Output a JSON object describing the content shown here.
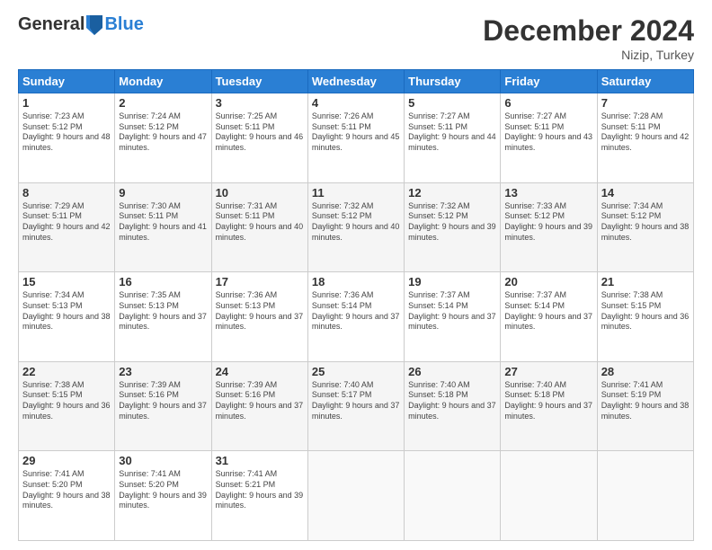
{
  "logo": {
    "general": "General",
    "blue": "Blue"
  },
  "header": {
    "month": "December 2024",
    "location": "Nizip, Turkey"
  },
  "weekdays": [
    "Sunday",
    "Monday",
    "Tuesday",
    "Wednesday",
    "Thursday",
    "Friday",
    "Saturday"
  ],
  "weeks": [
    [
      {
        "day": "1",
        "sunrise": "7:23 AM",
        "sunset": "5:12 PM",
        "daylight": "9 hours and 48 minutes."
      },
      {
        "day": "2",
        "sunrise": "7:24 AM",
        "sunset": "5:12 PM",
        "daylight": "9 hours and 47 minutes."
      },
      {
        "day": "3",
        "sunrise": "7:25 AM",
        "sunset": "5:11 PM",
        "daylight": "9 hours and 46 minutes."
      },
      {
        "day": "4",
        "sunrise": "7:26 AM",
        "sunset": "5:11 PM",
        "daylight": "9 hours and 45 minutes."
      },
      {
        "day": "5",
        "sunrise": "7:27 AM",
        "sunset": "5:11 PM",
        "daylight": "9 hours and 44 minutes."
      },
      {
        "day": "6",
        "sunrise": "7:27 AM",
        "sunset": "5:11 PM",
        "daylight": "9 hours and 43 minutes."
      },
      {
        "day": "7",
        "sunrise": "7:28 AM",
        "sunset": "5:11 PM",
        "daylight": "9 hours and 42 minutes."
      }
    ],
    [
      {
        "day": "8",
        "sunrise": "7:29 AM",
        "sunset": "5:11 PM",
        "daylight": "9 hours and 42 minutes."
      },
      {
        "day": "9",
        "sunrise": "7:30 AM",
        "sunset": "5:11 PM",
        "daylight": "9 hours and 41 minutes."
      },
      {
        "day": "10",
        "sunrise": "7:31 AM",
        "sunset": "5:11 PM",
        "daylight": "9 hours and 40 minutes."
      },
      {
        "day": "11",
        "sunrise": "7:32 AM",
        "sunset": "5:12 PM",
        "daylight": "9 hours and 40 minutes."
      },
      {
        "day": "12",
        "sunrise": "7:32 AM",
        "sunset": "5:12 PM",
        "daylight": "9 hours and 39 minutes."
      },
      {
        "day": "13",
        "sunrise": "7:33 AM",
        "sunset": "5:12 PM",
        "daylight": "9 hours and 39 minutes."
      },
      {
        "day": "14",
        "sunrise": "7:34 AM",
        "sunset": "5:12 PM",
        "daylight": "9 hours and 38 minutes."
      }
    ],
    [
      {
        "day": "15",
        "sunrise": "7:34 AM",
        "sunset": "5:13 PM",
        "daylight": "9 hours and 38 minutes."
      },
      {
        "day": "16",
        "sunrise": "7:35 AM",
        "sunset": "5:13 PM",
        "daylight": "9 hours and 37 minutes."
      },
      {
        "day": "17",
        "sunrise": "7:36 AM",
        "sunset": "5:13 PM",
        "daylight": "9 hours and 37 minutes."
      },
      {
        "day": "18",
        "sunrise": "7:36 AM",
        "sunset": "5:14 PM",
        "daylight": "9 hours and 37 minutes."
      },
      {
        "day": "19",
        "sunrise": "7:37 AM",
        "sunset": "5:14 PM",
        "daylight": "9 hours and 37 minutes."
      },
      {
        "day": "20",
        "sunrise": "7:37 AM",
        "sunset": "5:14 PM",
        "daylight": "9 hours and 37 minutes."
      },
      {
        "day": "21",
        "sunrise": "7:38 AM",
        "sunset": "5:15 PM",
        "daylight": "9 hours and 36 minutes."
      }
    ],
    [
      {
        "day": "22",
        "sunrise": "7:38 AM",
        "sunset": "5:15 PM",
        "daylight": "9 hours and 36 minutes."
      },
      {
        "day": "23",
        "sunrise": "7:39 AM",
        "sunset": "5:16 PM",
        "daylight": "9 hours and 37 minutes."
      },
      {
        "day": "24",
        "sunrise": "7:39 AM",
        "sunset": "5:16 PM",
        "daylight": "9 hours and 37 minutes."
      },
      {
        "day": "25",
        "sunrise": "7:40 AM",
        "sunset": "5:17 PM",
        "daylight": "9 hours and 37 minutes."
      },
      {
        "day": "26",
        "sunrise": "7:40 AM",
        "sunset": "5:18 PM",
        "daylight": "9 hours and 37 minutes."
      },
      {
        "day": "27",
        "sunrise": "7:40 AM",
        "sunset": "5:18 PM",
        "daylight": "9 hours and 37 minutes."
      },
      {
        "day": "28",
        "sunrise": "7:41 AM",
        "sunset": "5:19 PM",
        "daylight": "9 hours and 38 minutes."
      }
    ],
    [
      {
        "day": "29",
        "sunrise": "7:41 AM",
        "sunset": "5:20 PM",
        "daylight": "9 hours and 38 minutes."
      },
      {
        "day": "30",
        "sunrise": "7:41 AM",
        "sunset": "5:20 PM",
        "daylight": "9 hours and 39 minutes."
      },
      {
        "day": "31",
        "sunrise": "7:41 AM",
        "sunset": "5:21 PM",
        "daylight": "9 hours and 39 minutes."
      },
      null,
      null,
      null,
      null
    ]
  ],
  "labels": {
    "sunrise": "Sunrise:",
    "sunset": "Sunset:",
    "daylight": "Daylight:"
  }
}
